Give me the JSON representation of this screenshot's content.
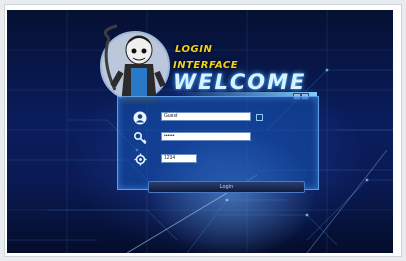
{
  "header": {
    "line1": "LOGIN",
    "line2": "INTERFACE",
    "welcome": "WELCOME"
  },
  "panel": {
    "corner_label": ""
  },
  "form": {
    "username_value": "Guest",
    "password_value": "••••••",
    "captcha_value": "1234",
    "remember_label": "",
    "help_label": "",
    "captcha_hint": "",
    "login_label": "Login"
  },
  "colors": {
    "title_yellow": "#f2d21a",
    "welcome_glow": "#49b0ff",
    "panel_blue": "#1450aa",
    "background_navy": "#0a1d5c"
  },
  "icons": [
    "user-icon",
    "key-icon",
    "gear-icon",
    "mascot-icon"
  ]
}
